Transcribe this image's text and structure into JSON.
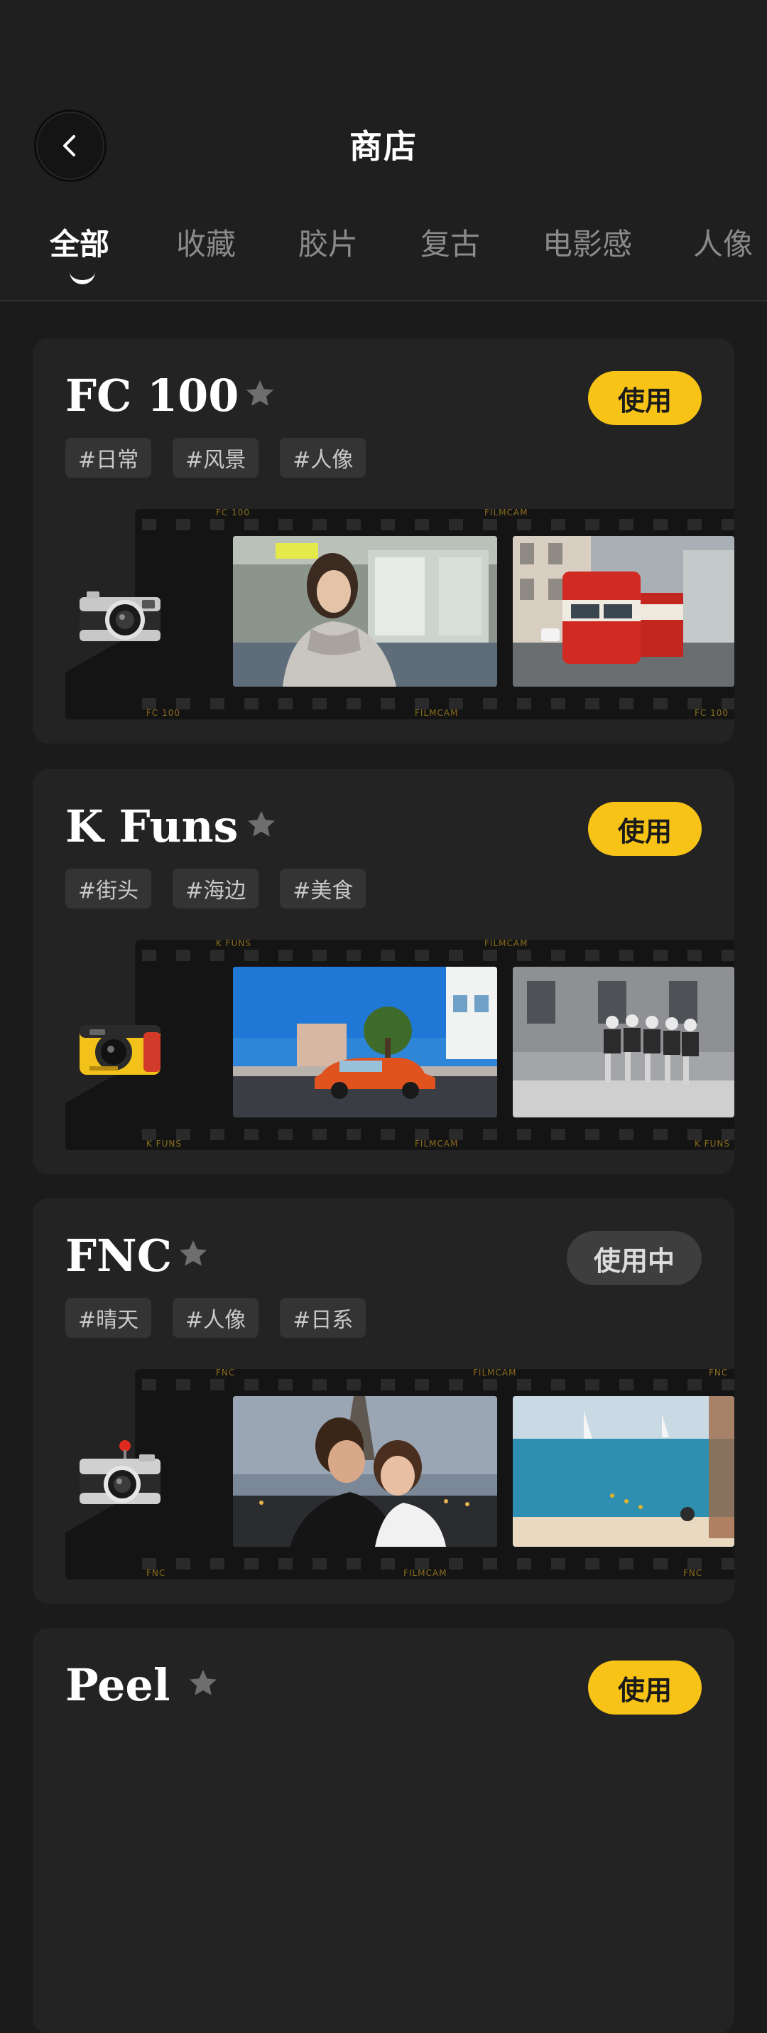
{
  "header": {
    "title": "商店",
    "back_icon": "chevron-left-icon"
  },
  "tabs": [
    {
      "label": "全部",
      "active": true
    },
    {
      "label": "收藏",
      "active": false
    },
    {
      "label": "胶片",
      "active": false
    },
    {
      "label": "复古",
      "active": false
    },
    {
      "label": "电影感",
      "active": false
    },
    {
      "label": "人像",
      "active": false
    }
  ],
  "colors": {
    "accent": "#f6c316",
    "background": "#1b1b1b",
    "card": "#232323",
    "in_use_button": "#3e3e3e"
  },
  "cards": [
    {
      "name": "FC 100",
      "button": "使用",
      "tags": [
        "#日常",
        "#风景",
        "#人像"
      ],
      "film_top_labels": [
        "FC 100",
        "FILMCAM"
      ],
      "film_bottom_labels": [
        "FC 100",
        "FILMCAM",
        "FC 100"
      ],
      "camera_icon": "silver-compact-camera-icon",
      "photos": [
        "woman-on-train-photo",
        "red-tram-photo"
      ]
    },
    {
      "name": "K Funs",
      "button": "使用",
      "tags": [
        "#街头",
        "#海边",
        "#美食"
      ],
      "film_top_labels": [
        "K FUNS",
        "FILMCAM"
      ],
      "film_bottom_labels": [
        "K FUNS",
        "FILMCAM",
        "K FUNS"
      ],
      "camera_icon": "yellow-disposable-camera-icon",
      "photos": [
        "red-vintage-car-photo",
        "friends-sitting-on-wall-photo"
      ]
    },
    {
      "name": "FNC",
      "button": "使用中",
      "tags": [
        "#晴天",
        "#人像",
        "#日系"
      ],
      "film_top_labels": [
        "FNC",
        "FILMCAM",
        "FNC"
      ],
      "film_bottom_labels": [
        "FNC",
        "FILMCAM",
        "FNC"
      ],
      "camera_icon": "silver-rangefinder-camera-icon",
      "photos": [
        "couple-eiffel-tower-photo",
        "beach-sea-photo"
      ]
    },
    {
      "name": "Peel",
      "button": "使用",
      "tags": [],
      "camera_icon": "",
      "photos": []
    }
  ]
}
